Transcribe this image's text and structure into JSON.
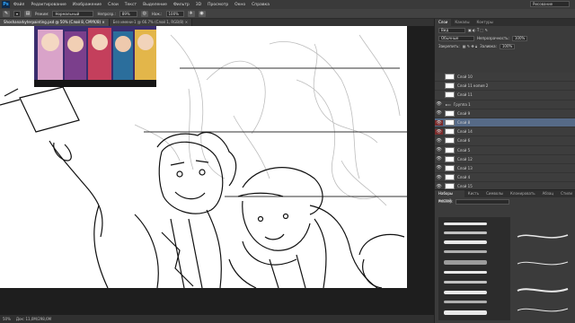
{
  "app": {
    "logo": "Ps",
    "workspace": "Рисование"
  },
  "menu": [
    "Файл",
    "Редактирование",
    "Изображение",
    "Слои",
    "Текст",
    "Выделение",
    "Фильтр",
    "3D",
    "Просмотр",
    "Окно",
    "Справка"
  ],
  "options": {
    "mode_label": "Режим:",
    "mode_value": "Нормальный",
    "opacity_label": "Непрозр.:",
    "opacity_value": "89%",
    "flow_label": "Наж.:",
    "flow_value": "100%"
  },
  "tabs": [
    {
      "label": "Shoshanarkyterpainting.psd @ 50% (Слой 8, CMYK/8) ×",
      "active": true
    },
    {
      "label": "Без имени-1 @ 66.7% (Слой 1, RGB/8) ×",
      "active": false
    }
  ],
  "status": {
    "zoom": "50%",
    "doc": "Док: 11,0М/298,6М"
  },
  "panel_tabs": [
    "Слои",
    "Каналы",
    "Контуры"
  ],
  "layers_panel": {
    "kind": "Вид",
    "blend": "Обычные",
    "opacity_label": "Непрозрачность:",
    "opacity_value": "100%",
    "lock_label": "Закрепить:",
    "fill_label": "Заливка:",
    "fill_value": "100%"
  },
  "layers": [
    {
      "name": "Слой 10",
      "visible": false,
      "selected": false,
      "red": false
    },
    {
      "name": "Слой 11 копия 2",
      "visible": false,
      "selected": false,
      "red": false
    },
    {
      "name": "Слой 11",
      "visible": false,
      "selected": false,
      "red": false
    },
    {
      "name": "Группа 1",
      "visible": true,
      "selected": false,
      "red": false
    },
    {
      "name": "Слой 9",
      "visible": true,
      "selected": false,
      "red": false
    },
    {
      "name": "Слой 8",
      "visible": true,
      "selected": true,
      "red": true
    },
    {
      "name": "Слой 14",
      "visible": true,
      "selected": false,
      "red": true
    },
    {
      "name": "Слой 6",
      "visible": true,
      "selected": false,
      "red": false
    },
    {
      "name": "Слой 5",
      "visible": true,
      "selected": false,
      "red": false
    },
    {
      "name": "Слой 12",
      "visible": true,
      "selected": false,
      "red": false
    },
    {
      "name": "Слой 13",
      "visible": true,
      "selected": false,
      "red": false
    },
    {
      "name": "Слой 4",
      "visible": true,
      "selected": false,
      "red": false
    },
    {
      "name": "Слой 15",
      "visible": true,
      "selected": false,
      "red": false
    }
  ],
  "brush_panel": {
    "tabs": [
      "Наборы кистей",
      "Кисть",
      "Символы",
      "Клонировать",
      "Абзац",
      "Стили"
    ],
    "size_label": "Размер:"
  }
}
